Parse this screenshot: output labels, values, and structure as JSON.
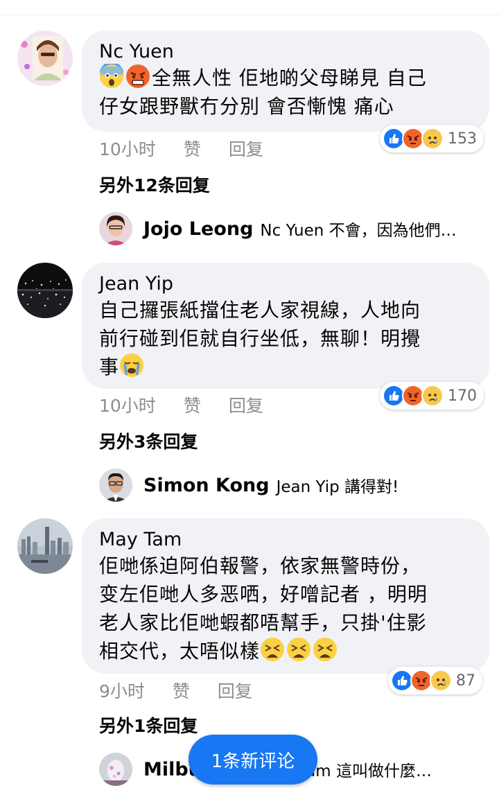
{
  "comments": [
    {
      "author": "Nc Yuen",
      "text_line1": "全無人性 佢地啲父母睇見 自己",
      "text_line2": "仔女跟野獸冇分別 會否慚愧 痛心",
      "time": "10小时",
      "like": "赞",
      "reply": "回复",
      "reaction_count": "153",
      "more_replies": "另外12条回复",
      "preview_name": "Jojo Leong",
      "preview_text": "Nc Yuen 不會，因為他們…"
    },
    {
      "author": "Jean Yip",
      "text_line1": "自己攞張紙擋住老人家視線，人地向",
      "text_line2": "前行碰到佢就自行坐低，無聊！明攪",
      "text_line3": "事",
      "time": "10小时",
      "like": "赞",
      "reply": "回复",
      "reaction_count": "170",
      "more_replies": "另外3条回复",
      "preview_name": "Simon  Kong",
      "preview_text": "Jean Yip 講得對!"
    },
    {
      "author": "May Tam",
      "text_line1": "佢哋係迫阿伯報警，依家無警時份，",
      "text_line2": "变左佢哋人多恶哂，好噌記者 ，明明",
      "text_line3": "老人家比佢哋蝦都唔幫手，只掛'住影",
      "text_line4": "相交代，太唔似樣",
      "time": "9小时",
      "like": "赞",
      "reply": "回复",
      "reaction_count": "87",
      "more_replies": "另外1条回复",
      "preview_name": "Milbu",
      "preview_text": "Tam 這叫做什麼…"
    }
  ],
  "new_comment_pill": "1条新评论",
  "colors": {
    "bubble": "#f0f2f5",
    "like_blue": "#1877f2",
    "angry": "#f05d2c",
    "sad_yellow": "#f7c94b",
    "meta": "#8a8d91"
  },
  "icons": [
    "fearful-face-emoji",
    "angry-face-emoji",
    "crying-face-emoji",
    "weary-face-emoji",
    "like-reaction-icon",
    "angry-reaction-icon",
    "sad-reaction-icon"
  ]
}
